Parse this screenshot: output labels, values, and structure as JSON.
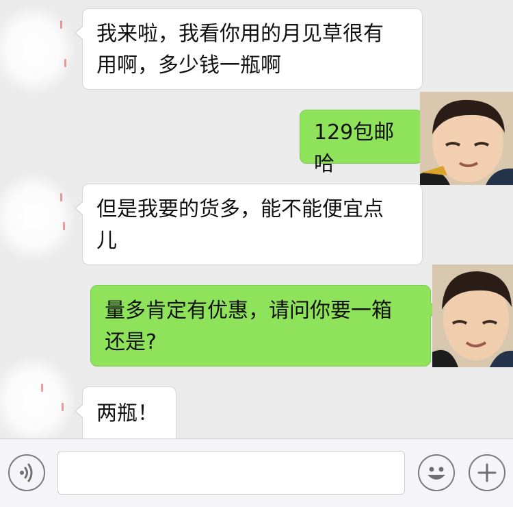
{
  "messages": [
    {
      "side": "in",
      "text_line1": "我来啦，我看你用的月见草很有",
      "text_line2": "用啊，多少钱一瓶啊"
    },
    {
      "side": "out",
      "text": "129包邮哈"
    },
    {
      "side": "in",
      "text_line1": "但是我要的货多，能不能便宜点",
      "text_line2": "儿"
    },
    {
      "side": "out",
      "text_line1": "量多肯定有优惠，请问你要一箱",
      "text_line2": "还是?"
    },
    {
      "side": "in",
      "text": "两瓶！"
    }
  ],
  "input_bar": {
    "placeholder": "",
    "icons": [
      "voice-icon",
      "emoji-icon",
      "plus-icon"
    ]
  },
  "colors": {
    "chat_background": "#ebebeb",
    "incoming_bubble": "#ffffff",
    "outgoing_bubble": "#8fe35a",
    "input_bar_background": "#f5f5f7"
  }
}
